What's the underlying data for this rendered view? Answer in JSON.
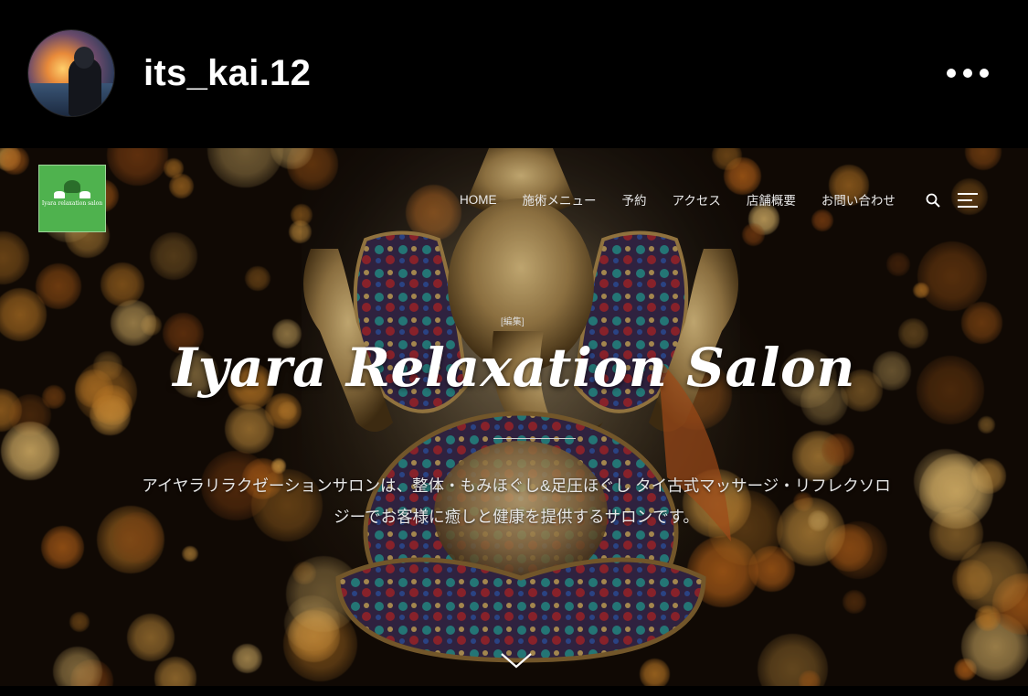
{
  "post": {
    "username": "its_kai.12",
    "avatar_icon": "profile-photo",
    "more_icon": "more-horizontal-icon"
  },
  "website": {
    "logo_text": "Iyara relaxation salon",
    "logo_color": "#4fb24e",
    "nav": {
      "items": [
        "HOME",
        "施術メニュー",
        "予約",
        "アクセス",
        "店舗概要",
        "お問い合わせ"
      ],
      "search_icon": "search-icon",
      "menu_icon": "hamburger-menu-icon"
    },
    "edit_link": "[編集]",
    "title": "Iyara Relaxation Salon",
    "tagline_line1": "アイヤラリラクゼーションサロンは、整体・もみほぐし&足圧ほぐし タイ古式マッサージ・リフレクソロ",
    "tagline_line2": "ジーでお客様に癒しと健康を提供するサロンです。",
    "scroll_icon": "chevron-down-icon"
  }
}
